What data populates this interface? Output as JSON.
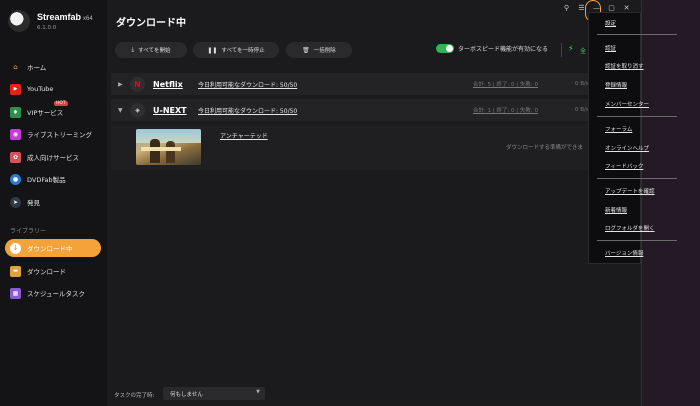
{
  "app": {
    "name": "Streamfab",
    "arch": "x64",
    "version": "6.1.0.0"
  },
  "sidebar": {
    "items": [
      {
        "label": "ホーム"
      },
      {
        "label": "YouTube"
      },
      {
        "label": "VIPサービス",
        "badge": "HOT"
      },
      {
        "label": "ライブストリーミング"
      },
      {
        "label": "成人向けサービス"
      },
      {
        "label": "DVDFab製品"
      },
      {
        "label": "発見"
      }
    ],
    "library_label": "ライブラリー",
    "library": [
      {
        "label": "ダウンロード中",
        "active": true
      },
      {
        "label": "ダウンロード"
      },
      {
        "label": "スケジュールタスク"
      }
    ]
  },
  "header": {
    "title": "ダウンロード中",
    "window_controls": [
      "⚲",
      "☰",
      "—",
      "▢",
      "✕"
    ]
  },
  "toolbar": {
    "start_all": "すべてを開始",
    "pause_all": "すべてを一時停止",
    "delete_all": "一括削除",
    "turbo_label": "ターボスピード機能が有効になる",
    "turbo_on": true,
    "turbo_extra": "全"
  },
  "services": [
    {
      "name": "Netflix",
      "quota": "今日利用可能なダウンロード: 50/50",
      "stats": "合計: 5 | 終了: 0 | 失敗: 0",
      "rate": "0 B/s",
      "expanded": false
    },
    {
      "name": "U-NEXT",
      "quota": "今日利用可能なダウンロード: 50/50",
      "stats": "合計: 1 | 終了: 0 | 失敗: 0",
      "rate": "0 B/s",
      "expanded": true
    }
  ],
  "items": [
    {
      "title": "アンチャーテッド",
      "status": "ダウンロードする準備ができま"
    }
  ],
  "footer": {
    "label": "タスクの完了時:",
    "select_value": "何もしません"
  },
  "menu": {
    "items": [
      "設定",
      "認証",
      "認証を取り消す",
      "登録情報",
      "メンバーセンター",
      "フォーラム",
      "オンラインヘルプ",
      "フィードバック",
      "アップデートを確認",
      "新着情報",
      "ログフォルダを開く",
      "バージョン情報"
    ]
  },
  "colors": {
    "accent": "#f4a33b",
    "toggle_on": "#2fb553",
    "netflix": "#e50914",
    "sidebar_bg": "#141416",
    "main_bg": "#1b1b1e"
  }
}
